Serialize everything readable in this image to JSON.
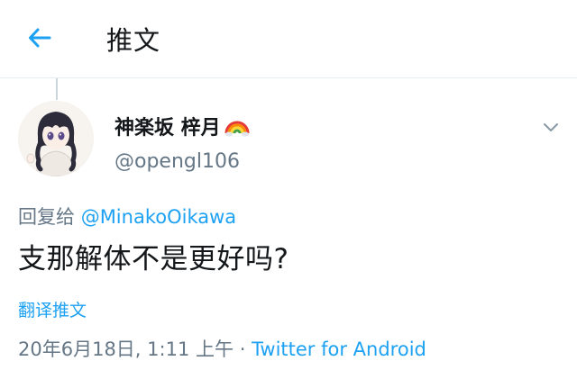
{
  "header": {
    "title": "推文",
    "back_icon": "arrow-left-icon",
    "accent_color": "#1da1f2"
  },
  "tweet": {
    "author": {
      "display_name": "神楽坂 梓月",
      "emoji_icon": "rainbow-icon",
      "handle": "@opengl106"
    },
    "reply_prefix": "回复给",
    "reply_to": "@MinakoOikawa",
    "text": "支那解体不是更好吗?",
    "translate_label": "翻译推文",
    "timestamp": "20年6月18日, 1:11 上午",
    "separator": "·",
    "source": "Twitter for Android"
  },
  "colors": {
    "text_primary": "#14171a",
    "text_secondary": "#657786",
    "link": "#1da1f2",
    "border": "#e6ecf0"
  }
}
